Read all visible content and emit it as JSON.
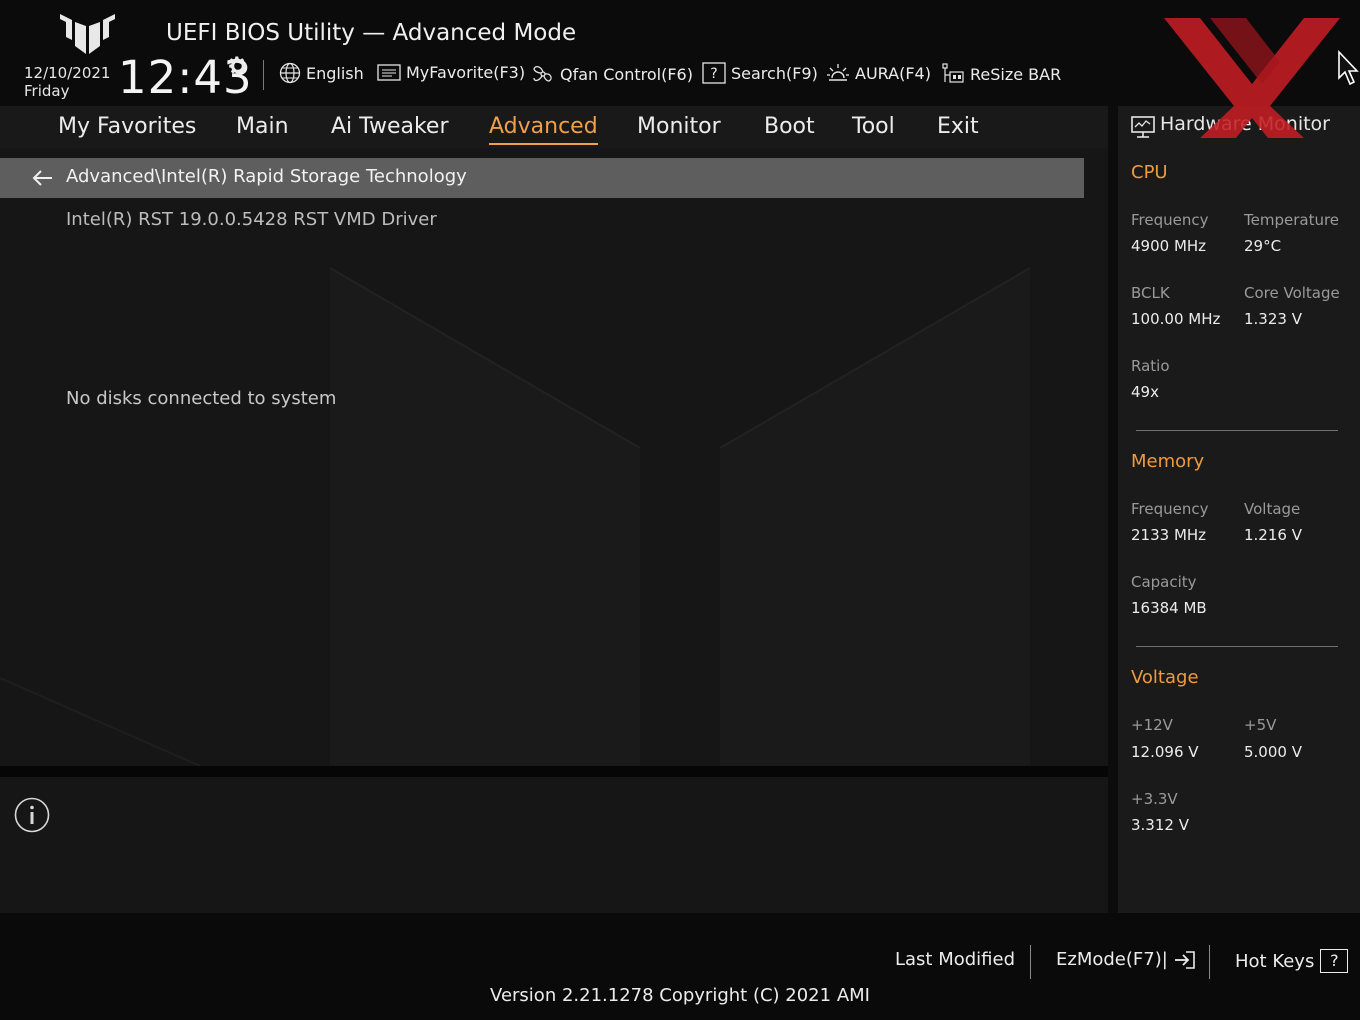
{
  "header": {
    "title": "UEFI BIOS Utility — Advanced Mode",
    "date": "12/10/2021",
    "weekday": "Friday",
    "time": "12:43",
    "toolbar": [
      {
        "label": "English",
        "icon": "globe-icon"
      },
      {
        "label": "MyFavorite(F3)",
        "icon": "favorite-list-icon"
      },
      {
        "label": "Qfan Control(F6)",
        "icon": "fan-icon"
      },
      {
        "label": "Search(F9)",
        "icon": "search-help-icon"
      },
      {
        "label": "AURA(F4)",
        "icon": "aura-light-icon"
      },
      {
        "label": "ReSize BAR",
        "icon": "resize-bar-icon"
      }
    ]
  },
  "tabs": [
    {
      "label": "My Favorites",
      "active": false
    },
    {
      "label": "Main",
      "active": false
    },
    {
      "label": "Ai Tweaker",
      "active": false
    },
    {
      "label": "Advanced",
      "active": true
    },
    {
      "label": "Monitor",
      "active": false
    },
    {
      "label": "Boot",
      "active": false
    },
    {
      "label": "Tool",
      "active": false
    },
    {
      "label": "Exit",
      "active": false
    }
  ],
  "main": {
    "breadcrumb": "Advanced\\Intel(R) Rapid Storage Technology",
    "driver": "Intel(R) RST 19.0.0.5428 RST VMD Driver",
    "message": "No disks connected to system"
  },
  "hardware_monitor": {
    "title": "Hardware Monitor",
    "cpu": {
      "heading": "CPU",
      "frequency_label": "Frequency",
      "frequency": "4900 MHz",
      "temperature_label": "Temperature",
      "temperature": "29°C",
      "bclk_label": "BCLK",
      "bclk": "100.00 MHz",
      "core_voltage_label": "Core Voltage",
      "core_voltage": "1.323 V",
      "ratio_label": "Ratio",
      "ratio": "49x"
    },
    "memory": {
      "heading": "Memory",
      "frequency_label": "Frequency",
      "frequency": "2133 MHz",
      "voltage_label": "Voltage",
      "voltage": "1.216 V",
      "capacity_label": "Capacity",
      "capacity": "16384 MB"
    },
    "voltage": {
      "heading": "Voltage",
      "v12_label": "+12V",
      "v12": "12.096 V",
      "v5_label": "+5V",
      "v5": "5.000 V",
      "v33_label": "+3.3V",
      "v33": "3.312 V"
    }
  },
  "footer": {
    "last_modified": "Last Modified",
    "ezmode": "EzMode(F7)|",
    "hotkeys": "Hot Keys",
    "hotkeys_icon": "?",
    "version": "Version 2.21.1278 Copyright (C) 2021 AMI"
  },
  "colors": {
    "accent": "#f0a04a",
    "watermark": "#c41e24",
    "breadcrumb_bg": "#5e5e5e"
  }
}
